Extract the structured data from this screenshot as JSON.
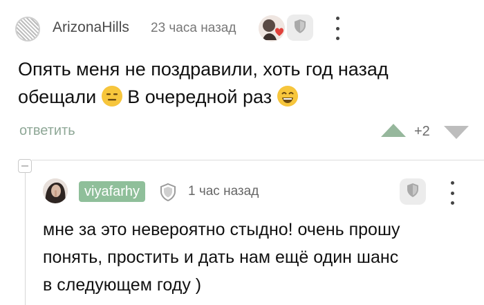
{
  "comment": {
    "author": "ArizonaHills",
    "time": "23 часа назад",
    "text_line1": "Опять меня не поздравили, хоть год назад",
    "text_line2_before": "обещали",
    "text_line2_after": "В очередной раз",
    "emoji_1": "expressionless-face",
    "emoji_2": "grinning-face",
    "reply_label": "ответить",
    "score": "+2"
  },
  "reply_comment": {
    "author": "viyafarhy",
    "time": "1 час назад",
    "text_line1": "мне за это невероятно стыдно! очень прошу",
    "text_line2": "понять, простить и дать нам ещё один шанс",
    "text_line3": "в следующем году )"
  },
  "colors": {
    "accent_green": "#8fbf9a",
    "upvote": "#96b79c",
    "downvote": "#bdbdbd",
    "reply_link": "#8ea796"
  }
}
